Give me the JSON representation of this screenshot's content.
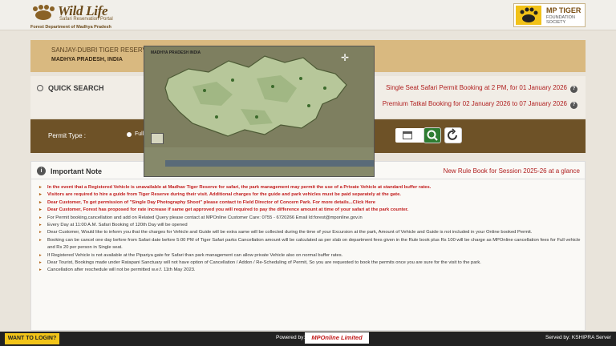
{
  "header": {
    "brand_title": "Wild Life",
    "brand_subtitle": "Safari Reservation Portal",
    "brand_dept": "Forest Department of Madhya Pradesh",
    "partner_name": "MP TIGER",
    "partner_sub": "FOUNDATION SOCIETY"
  },
  "reserve": {
    "name": "SANJAY-DUBRI TIGER RESERVE",
    "state": "MADHYA PRADESH, INDIA"
  },
  "quick_search": {
    "title": "QUICK SEARCH",
    "schedule_1": "Single Seat Safari Permit Booking at 2 PM, for 01 January 2026",
    "schedule_2": "Premium Tatkal Booking for 02 January 2026 to 07 January 2026",
    "help_glyph": "?"
  },
  "permit": {
    "label": "Permit Type :",
    "option_visible": "Full"
  },
  "map_popup": {
    "title": "MADHYA PRADESH INDIA"
  },
  "notes": {
    "title": "Important Note",
    "info_glyph": "i",
    "rulebook_link": "New Rule Book for Session 2025-26 at a glance",
    "items": [
      "In the event that a Registered Vehicle is unavailable at Madhav Tiger Reserve for safari, the park management may permit the use of a Private Vehicle at standard buffer rates.",
      "Visitors are required to hire a guide from Tiger Reserve during their visit. Additional charges for the guide and park vehicles must be paid separately at the gate.",
      "Dear Customer, To get permission of \"Single Day Photography Shoot\" please contact to Field Director of Concern Park. For more details...Click Here",
      "Dear Customer, Forest has proposed for rate increase if same get approved you will required to pay the difference amount at time of your safari at the park counter.",
      "For Permit booking,cancellation and add on Related Query please contact at MPOnline Customer Care: 0755 - 6720266 Email Id:forest@mponline.gov.in",
      "Every Day at 11:00 A.M. Safari Booking of 120th Day will be opened",
      "Dear Customer, Would like to inform you that the charges for Vehicle and Guide will be extra same will be collected during the time of your Excursion at the park, Amount of Vehicle and Guide is not included in your Online booked Permit.",
      "Booking can be cancel one day before from Safari date before 5:00 PM of Tiger Safari parks Cancellation amount will be calculated as per slab on department fees given in the Rule book plus Rs 100 will be charge as MPOnline cancellation fees for Full vehicle and Rs 20 per person in Single seat.",
      "If Registered Vehicle is not available at the Pipariya gate for Safari than park management can allow private Vehicle also on normal buffer rates.",
      "Dear Tourist, Bookings made under Ratapani Sanctuary will not have option of Cancellation / Addon / Re-Scheduling of Permit, So you are requested to book the permits once you are sure for the visit to the park.",
      "Cancellation after reschedule will not be permitted w.e.f. 11th May 2023."
    ]
  },
  "footer": {
    "login": "WANT TO LOGIN?",
    "powered": "Powered by:",
    "mponline": "MPOnline Limited",
    "served": "Served by: KSHIPRA Server"
  },
  "colors": {
    "permit_bar": "#6e5227",
    "reserve_band": "#d9b980",
    "accent_red": "#b02020",
    "search_green": "#2e7d32"
  }
}
